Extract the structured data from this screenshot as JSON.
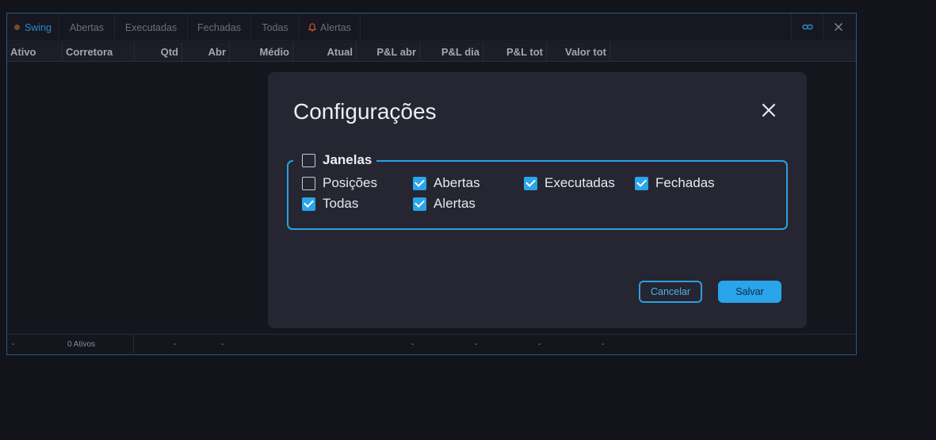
{
  "tabs": [
    {
      "label": "Swing",
      "active": true
    },
    {
      "label": "Abertas"
    },
    {
      "label": "Executadas"
    },
    {
      "label": "Fechadas"
    },
    {
      "label": "Todas"
    },
    {
      "label": "Alertas"
    }
  ],
  "columns": [
    "Ativo",
    "Corretora",
    "Qtd",
    "Abr",
    "Médio",
    "Atual",
    "P&L abr",
    "P&L dia",
    "P&L tot",
    "Valor tot"
  ],
  "footer": {
    "ativo": "-",
    "count": "0 Ativos",
    "qtd": "-",
    "abr": "-",
    "pl_abr": "-",
    "pl_dia": "-",
    "pl_tot": "-",
    "valor_tot": "-"
  },
  "modal": {
    "title": "Configurações",
    "group_label": "Janelas",
    "group_checked": false,
    "options": [
      {
        "label": "Posições",
        "checked": false
      },
      {
        "label": "Abertas",
        "checked": true
      },
      {
        "label": "Executadas",
        "checked": true
      },
      {
        "label": "Fechadas",
        "checked": true
      },
      {
        "label": "Todas",
        "checked": true
      },
      {
        "label": "Alertas",
        "checked": true
      }
    ],
    "cancel_label": "Cancelar",
    "save_label": "Salvar"
  },
  "colors": {
    "accent": "#2aa4ea",
    "border": "#2c9fe0",
    "alert_icon": "#c4552a",
    "swing_dot": "#7a4a2b"
  },
  "icons": {
    "tab_swing": "status-dot-icon",
    "tab_alertas": "bell-icon",
    "link_button": "link-icon",
    "close_button": "close-icon",
    "modal_close": "close-icon"
  }
}
